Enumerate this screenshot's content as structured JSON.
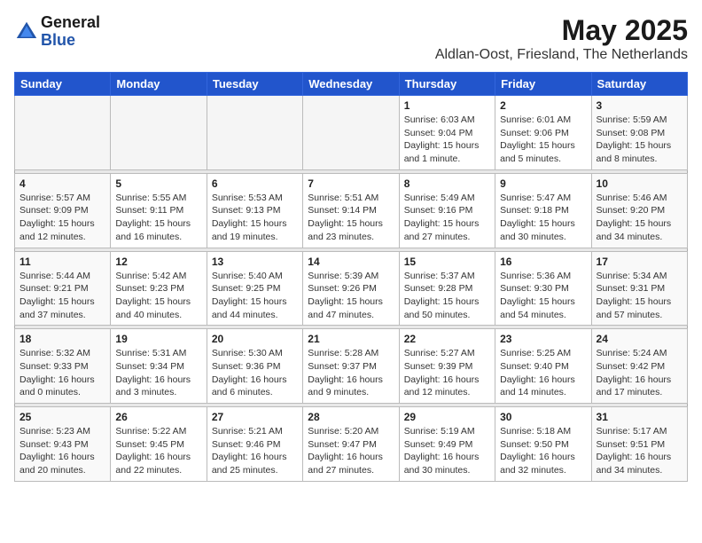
{
  "logo": {
    "general": "General",
    "blue": "Blue"
  },
  "header": {
    "month": "May 2025",
    "location": "Aldlan-Oost, Friesland, The Netherlands"
  },
  "weekdays": [
    "Sunday",
    "Monday",
    "Tuesday",
    "Wednesday",
    "Thursday",
    "Friday",
    "Saturday"
  ],
  "weeks": [
    [
      {
        "day": "",
        "info": ""
      },
      {
        "day": "",
        "info": ""
      },
      {
        "day": "",
        "info": ""
      },
      {
        "day": "",
        "info": ""
      },
      {
        "day": "1",
        "info": "Sunrise: 6:03 AM\nSunset: 9:04 PM\nDaylight: 15 hours\nand 1 minute."
      },
      {
        "day": "2",
        "info": "Sunrise: 6:01 AM\nSunset: 9:06 PM\nDaylight: 15 hours\nand 5 minutes."
      },
      {
        "day": "3",
        "info": "Sunrise: 5:59 AM\nSunset: 9:08 PM\nDaylight: 15 hours\nand 8 minutes."
      }
    ],
    [
      {
        "day": "4",
        "info": "Sunrise: 5:57 AM\nSunset: 9:09 PM\nDaylight: 15 hours\nand 12 minutes."
      },
      {
        "day": "5",
        "info": "Sunrise: 5:55 AM\nSunset: 9:11 PM\nDaylight: 15 hours\nand 16 minutes."
      },
      {
        "day": "6",
        "info": "Sunrise: 5:53 AM\nSunset: 9:13 PM\nDaylight: 15 hours\nand 19 minutes."
      },
      {
        "day": "7",
        "info": "Sunrise: 5:51 AM\nSunset: 9:14 PM\nDaylight: 15 hours\nand 23 minutes."
      },
      {
        "day": "8",
        "info": "Sunrise: 5:49 AM\nSunset: 9:16 PM\nDaylight: 15 hours\nand 27 minutes."
      },
      {
        "day": "9",
        "info": "Sunrise: 5:47 AM\nSunset: 9:18 PM\nDaylight: 15 hours\nand 30 minutes."
      },
      {
        "day": "10",
        "info": "Sunrise: 5:46 AM\nSunset: 9:20 PM\nDaylight: 15 hours\nand 34 minutes."
      }
    ],
    [
      {
        "day": "11",
        "info": "Sunrise: 5:44 AM\nSunset: 9:21 PM\nDaylight: 15 hours\nand 37 minutes."
      },
      {
        "day": "12",
        "info": "Sunrise: 5:42 AM\nSunset: 9:23 PM\nDaylight: 15 hours\nand 40 minutes."
      },
      {
        "day": "13",
        "info": "Sunrise: 5:40 AM\nSunset: 9:25 PM\nDaylight: 15 hours\nand 44 minutes."
      },
      {
        "day": "14",
        "info": "Sunrise: 5:39 AM\nSunset: 9:26 PM\nDaylight: 15 hours\nand 47 minutes."
      },
      {
        "day": "15",
        "info": "Sunrise: 5:37 AM\nSunset: 9:28 PM\nDaylight: 15 hours\nand 50 minutes."
      },
      {
        "day": "16",
        "info": "Sunrise: 5:36 AM\nSunset: 9:30 PM\nDaylight: 15 hours\nand 54 minutes."
      },
      {
        "day": "17",
        "info": "Sunrise: 5:34 AM\nSunset: 9:31 PM\nDaylight: 15 hours\nand 57 minutes."
      }
    ],
    [
      {
        "day": "18",
        "info": "Sunrise: 5:32 AM\nSunset: 9:33 PM\nDaylight: 16 hours\nand 0 minutes."
      },
      {
        "day": "19",
        "info": "Sunrise: 5:31 AM\nSunset: 9:34 PM\nDaylight: 16 hours\nand 3 minutes."
      },
      {
        "day": "20",
        "info": "Sunrise: 5:30 AM\nSunset: 9:36 PM\nDaylight: 16 hours\nand 6 minutes."
      },
      {
        "day": "21",
        "info": "Sunrise: 5:28 AM\nSunset: 9:37 PM\nDaylight: 16 hours\nand 9 minutes."
      },
      {
        "day": "22",
        "info": "Sunrise: 5:27 AM\nSunset: 9:39 PM\nDaylight: 16 hours\nand 12 minutes."
      },
      {
        "day": "23",
        "info": "Sunrise: 5:25 AM\nSunset: 9:40 PM\nDaylight: 16 hours\nand 14 minutes."
      },
      {
        "day": "24",
        "info": "Sunrise: 5:24 AM\nSunset: 9:42 PM\nDaylight: 16 hours\nand 17 minutes."
      }
    ],
    [
      {
        "day": "25",
        "info": "Sunrise: 5:23 AM\nSunset: 9:43 PM\nDaylight: 16 hours\nand 20 minutes."
      },
      {
        "day": "26",
        "info": "Sunrise: 5:22 AM\nSunset: 9:45 PM\nDaylight: 16 hours\nand 22 minutes."
      },
      {
        "day": "27",
        "info": "Sunrise: 5:21 AM\nSunset: 9:46 PM\nDaylight: 16 hours\nand 25 minutes."
      },
      {
        "day": "28",
        "info": "Sunrise: 5:20 AM\nSunset: 9:47 PM\nDaylight: 16 hours\nand 27 minutes."
      },
      {
        "day": "29",
        "info": "Sunrise: 5:19 AM\nSunset: 9:49 PM\nDaylight: 16 hours\nand 30 minutes."
      },
      {
        "day": "30",
        "info": "Sunrise: 5:18 AM\nSunset: 9:50 PM\nDaylight: 16 hours\nand 32 minutes."
      },
      {
        "day": "31",
        "info": "Sunrise: 5:17 AM\nSunset: 9:51 PM\nDaylight: 16 hours\nand 34 minutes."
      }
    ]
  ]
}
